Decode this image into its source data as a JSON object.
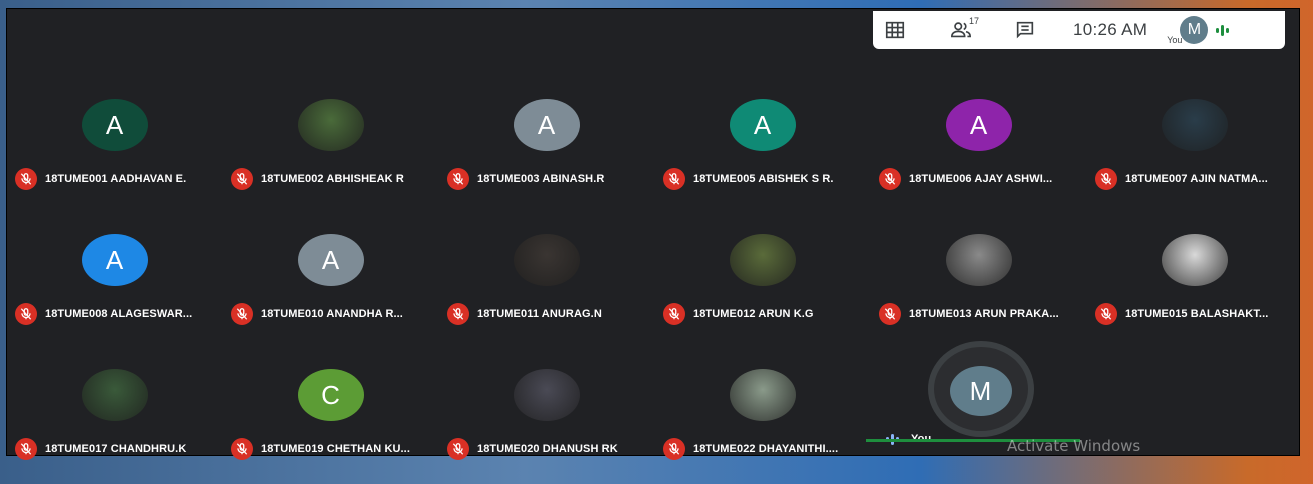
{
  "toolbar": {
    "participant_count": "17",
    "time": "10:26 AM",
    "self_label": "You",
    "self_initial": "M",
    "icons": [
      "grid-layout-icon",
      "people-icon",
      "chat-icon"
    ]
  },
  "participants": [
    {
      "name": "18TUME001 AADHAVAN E.",
      "initial": "A",
      "color": "#104c3a",
      "photo": false
    },
    {
      "name": "18TUME002 ABHISHEAK R",
      "initial": "",
      "color": "#4a6b3a",
      "photo": true
    },
    {
      "name": "18TUME003 ABINASH.R",
      "initial": "A",
      "color": "#7e8c96",
      "photo": false
    },
    {
      "name": "18TUME005 ABISHEK S R.",
      "initial": "A",
      "color": "#0f8a75",
      "photo": false
    },
    {
      "name": "18TUME006 AJAY ASHWI...",
      "initial": "A",
      "color": "#8e24aa",
      "photo": false
    },
    {
      "name": "18TUME007 AJIN NATMA...",
      "initial": "",
      "color": "#2a3d4a",
      "photo": true
    },
    {
      "name": "18TUME008 ALAGESWAR...",
      "initial": "A",
      "color": "#1e88e5",
      "photo": false
    },
    {
      "name": "18TUME010 ANANDHA R...",
      "initial": "A",
      "color": "#7e8c96",
      "photo": false
    },
    {
      "name": "18TUME011 ANURAG.N",
      "initial": "",
      "color": "#3a3532",
      "photo": true
    },
    {
      "name": "18TUME012 ARUN K.G",
      "initial": "",
      "color": "#5a6b3a",
      "photo": true
    },
    {
      "name": "18TUME013 ARUN PRAKA...",
      "initial": "",
      "color": "#8a8a8a",
      "photo": true
    },
    {
      "name": "18TUME015 BALASHAKT...",
      "initial": "",
      "color": "#d9d9d9",
      "photo": true
    },
    {
      "name": "18TUME017 CHANDHRU.K",
      "initial": "",
      "color": "#3a5a3a",
      "photo": true
    },
    {
      "name": "18TUME019 CHETHAN KU...",
      "initial": "C",
      "color": "#5c9c35",
      "photo": false
    },
    {
      "name": "18TUME020 DHANUSH RK",
      "initial": "",
      "color": "#4a4a55",
      "photo": true
    },
    {
      "name": "18TUME022 DHAYANITHI....",
      "initial": "",
      "color": "#8a9a8a",
      "photo": true
    }
  ],
  "self_tile": {
    "name": "You",
    "initial": "M",
    "color": "#607d8b"
  },
  "watermark": "Activate Windows"
}
